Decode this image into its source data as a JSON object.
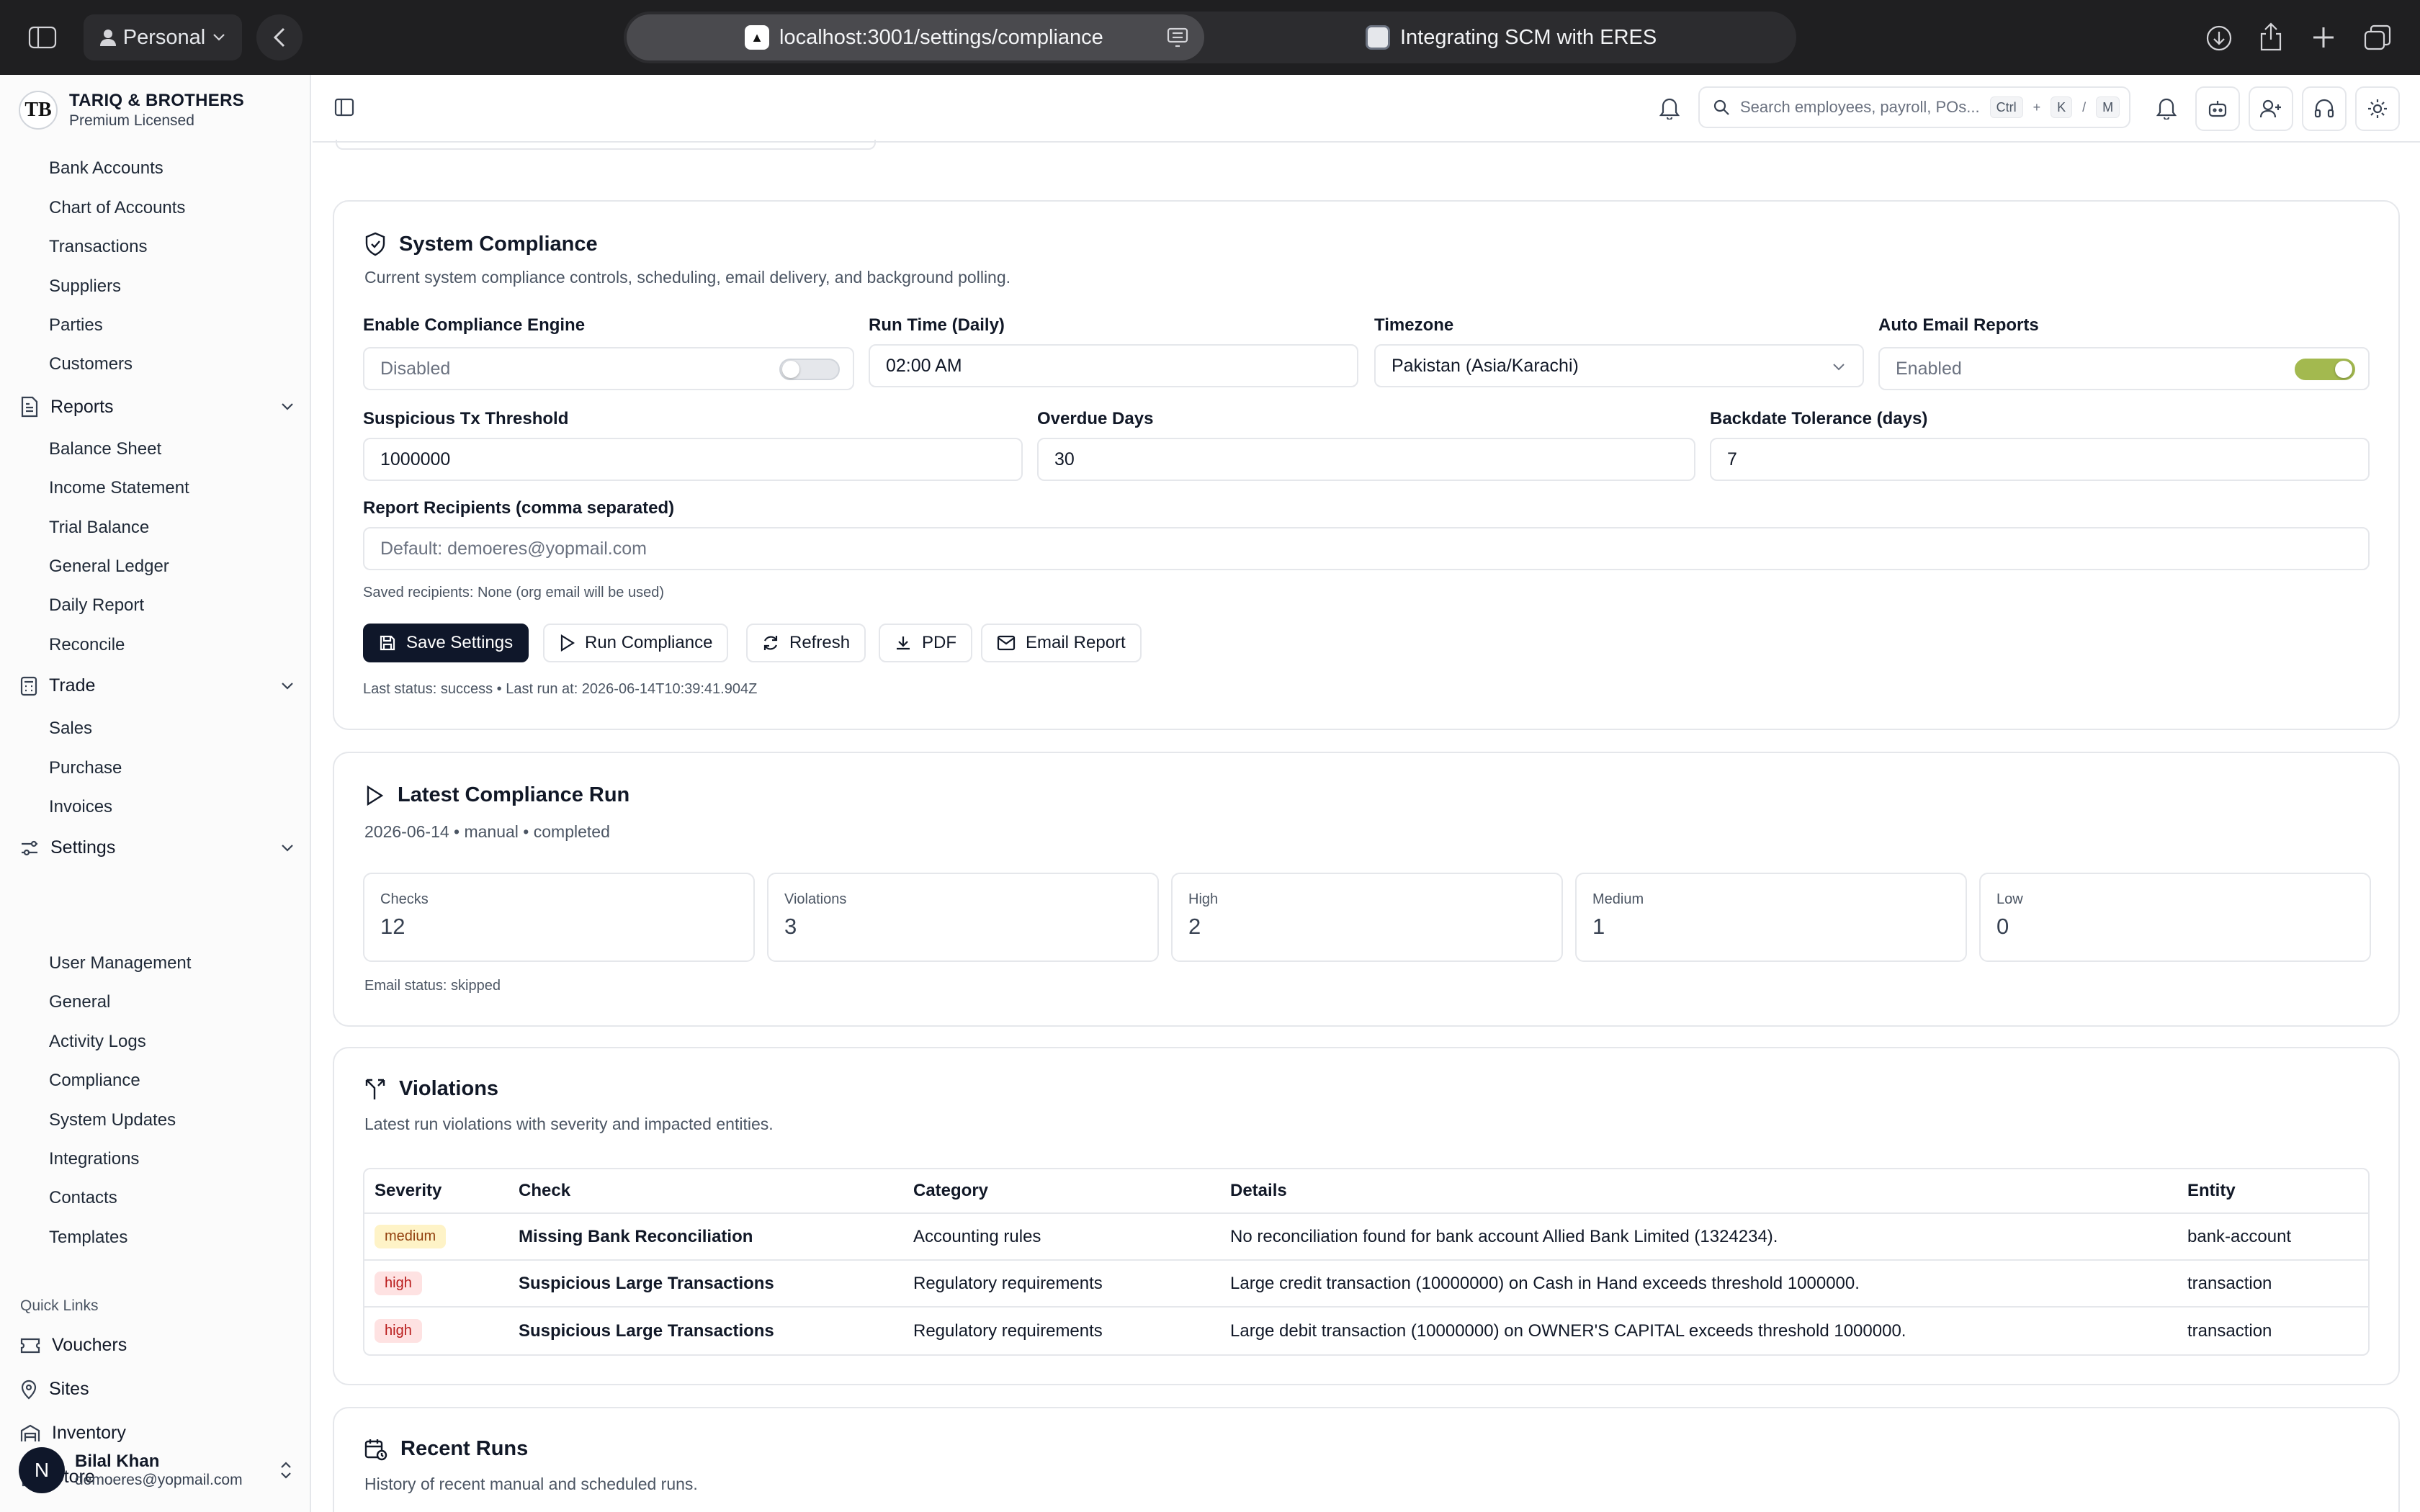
{
  "browser": {
    "profile": "Personal",
    "url": "localhost:3001/settings/compliance",
    "tab_title": "Integrating SCM with ERES"
  },
  "sidebar": {
    "org_name": "TARIQ & BROTHERS",
    "org_plan": "Premium Licensed",
    "accounts_items": [
      "Bank Accounts",
      "Chart of Accounts",
      "Transactions",
      "Suppliers",
      "Parties",
      "Customers"
    ],
    "reports": {
      "label": "Reports",
      "items": [
        "Balance Sheet",
        "Income Statement",
        "Trial Balance",
        "General Ledger",
        "Daily Report",
        "Reconcile"
      ]
    },
    "trade": {
      "label": "Trade",
      "items": [
        "Sales",
        "Purchase",
        "Invoices"
      ]
    },
    "settings": {
      "label": "Settings",
      "items": [
        "User Management",
        "General",
        "Activity Logs",
        "Compliance",
        "System Updates",
        "Integrations",
        "Contacts",
        "Templates"
      ]
    },
    "quick_links_label": "Quick Links",
    "quick_links": [
      "Vouchers",
      "Sites",
      "Inventory",
      "Store"
    ],
    "user": {
      "initial": "N",
      "name": "Bilal Khan",
      "email": "demoeres@yopmail.com"
    }
  },
  "topbar": {
    "search_placeholder": "Search employees, payroll, POs...",
    "shortcut": [
      "Ctrl",
      "+",
      "K",
      "/",
      "M"
    ]
  },
  "system_compliance": {
    "title": "System Compliance",
    "description": "Current system compliance controls, scheduling, email delivery, and background polling.",
    "enable_label": "Enable Compliance Engine",
    "enable_value": "Disabled",
    "enable_on": false,
    "run_time_label": "Run Time (Daily)",
    "run_time_value": "02:00 AM",
    "timezone_label": "Timezone",
    "timezone_value": "Pakistan (Asia/Karachi)",
    "auto_email_label": "Auto Email Reports",
    "auto_email_value": "Enabled",
    "auto_email_on": true,
    "threshold_label": "Suspicious Tx Threshold",
    "threshold_value": "1000000",
    "overdue_label": "Overdue Days",
    "overdue_value": "30",
    "backdate_label": "Backdate Tolerance (days)",
    "backdate_value": "7",
    "recipients_label": "Report Recipients (comma separated)",
    "recipients_placeholder": "Default: demoeres@yopmail.com",
    "saved_recipients": "Saved recipients: None (org email will be used)",
    "buttons": {
      "save": "Save Settings",
      "run": "Run Compliance",
      "refresh": "Refresh",
      "pdf": "PDF",
      "email": "Email Report"
    },
    "status_line": "Last status: success • Last run at: 2026-06-14T10:39:41.904Z"
  },
  "latest_run": {
    "title": "Latest Compliance Run",
    "meta": "2026-06-14 • manual • completed",
    "stats": [
      {
        "label": "Checks",
        "value": "12"
      },
      {
        "label": "Violations",
        "value": "3"
      },
      {
        "label": "High",
        "value": "2"
      },
      {
        "label": "Medium",
        "value": "1"
      },
      {
        "label": "Low",
        "value": "0"
      }
    ],
    "email_status": "Email status: skipped"
  },
  "violations": {
    "title": "Violations",
    "description": "Latest run violations with severity and impacted entities.",
    "columns": [
      "Severity",
      "Check",
      "Category",
      "Details",
      "Entity"
    ],
    "rows": [
      {
        "severity": "medium",
        "check": "Missing Bank Reconciliation",
        "category": "Accounting rules",
        "details": "No reconciliation found for bank account Allied Bank Limited (1324234).",
        "entity": "bank-account"
      },
      {
        "severity": "high",
        "check": "Suspicious Large Transactions",
        "category": "Regulatory requirements",
        "details": "Large credit transaction (10000000) on Cash in Hand exceeds threshold 1000000.",
        "entity": "transaction"
      },
      {
        "severity": "high",
        "check": "Suspicious Large Transactions",
        "category": "Regulatory requirements",
        "details": "Large debit transaction (10000000) on OWNER'S CAPITAL exceeds threshold 1000000.",
        "entity": "transaction"
      }
    ]
  },
  "recent_runs": {
    "title": "Recent Runs",
    "description": "History of recent manual and scheduled runs."
  }
}
